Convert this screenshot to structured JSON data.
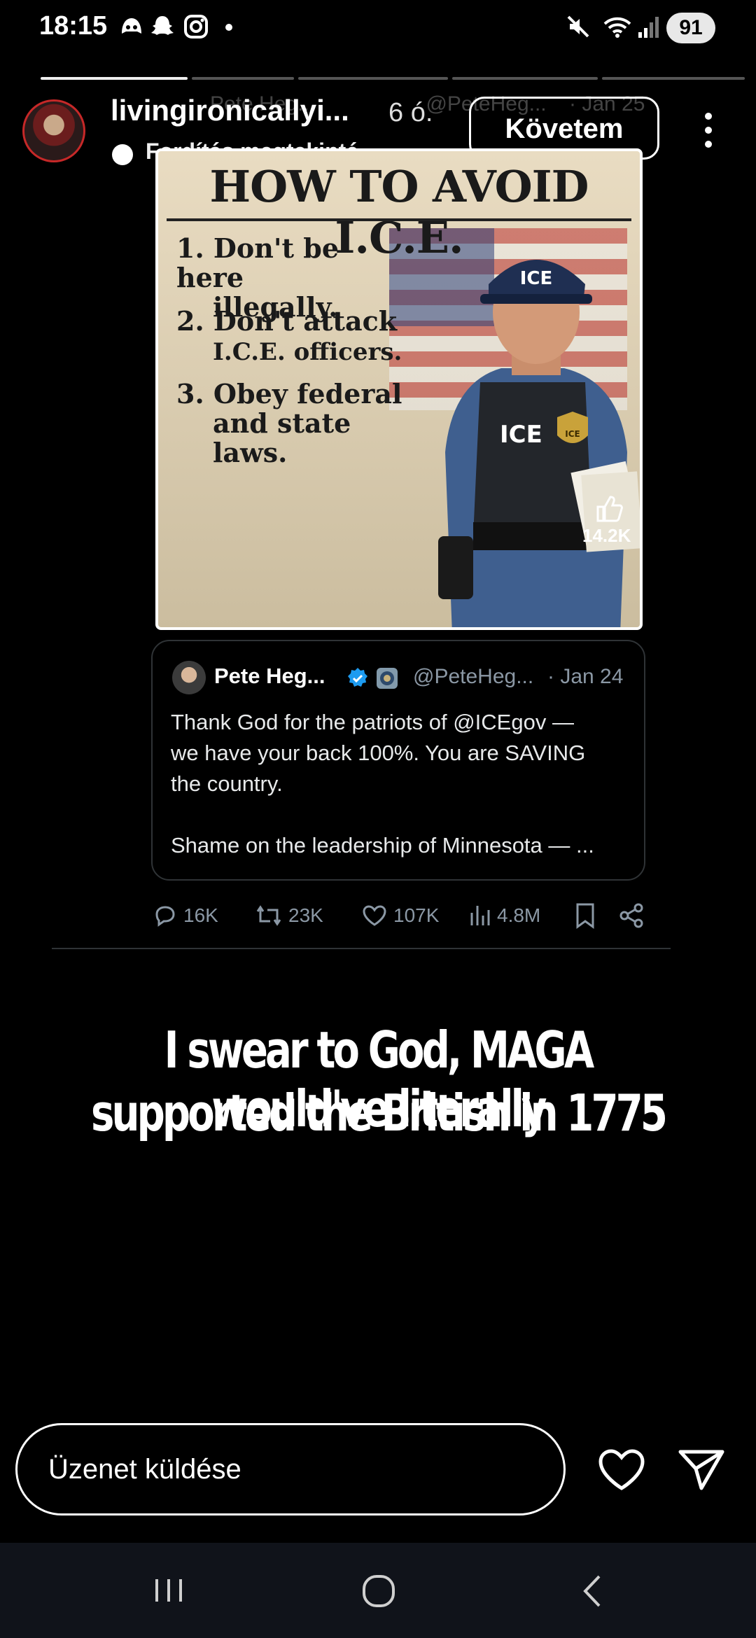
{
  "status_bar": {
    "time": "18:15",
    "battery": "91",
    "icons": [
      "discord-icon",
      "snapchat-icon",
      "instagram-icon",
      "dot-icon",
      "mute-icon",
      "wifi-icon",
      "signal-icon"
    ]
  },
  "story": {
    "username": "livingironicallyi...",
    "time_ago": "6 ó.",
    "translate_label": "Fordítás megtekinté...",
    "follow_label": "Követem",
    "progress_segments": 5,
    "background_tweet": {
      "name": "Pete Heg...",
      "handle": "@PeteHeg...",
      "date": "· Jan 25"
    },
    "poster": {
      "title": "HOW TO AVOID I.C.E.",
      "items": [
        [
          "1.",
          "Don't be here",
          "illegally."
        ],
        [
          "2.",
          "Don't attack",
          "I.C.E. officers."
        ],
        [
          "3.",
          "Obey federal",
          "and state",
          "laws."
        ]
      ],
      "cap_text": "ICE",
      "vest_text": "ICE",
      "badge_text": "ICE",
      "like_count": "14.2K"
    },
    "quoted_tweet": {
      "name": "Pete Heg...",
      "handle": "@PeteHeg...",
      "date": "· Jan 24",
      "lines": [
        "Thank God for the patriots of @ICEgov —",
        "we have your back 100%. You are SAVING",
        "the country.",
        "Shame on the leadership of Minnesota — ..."
      ]
    },
    "actions": {
      "replies": "16K",
      "retweets": "23K",
      "likes": "107K",
      "views": "4.8M"
    },
    "caption_lines": [
      "I swear to God, MAGA would've literally",
      "supported the British  in 1775"
    ]
  },
  "message_bar": {
    "placeholder": "Üzenet küldése"
  },
  "nav_bar": {
    "buttons": [
      "recents-button",
      "home-button",
      "back-button"
    ]
  },
  "colors": {
    "background": "#000000",
    "tweet_muted": "#8b98a5",
    "verified_blue": "#1d9bf0",
    "follow_border": "#ffffff"
  }
}
